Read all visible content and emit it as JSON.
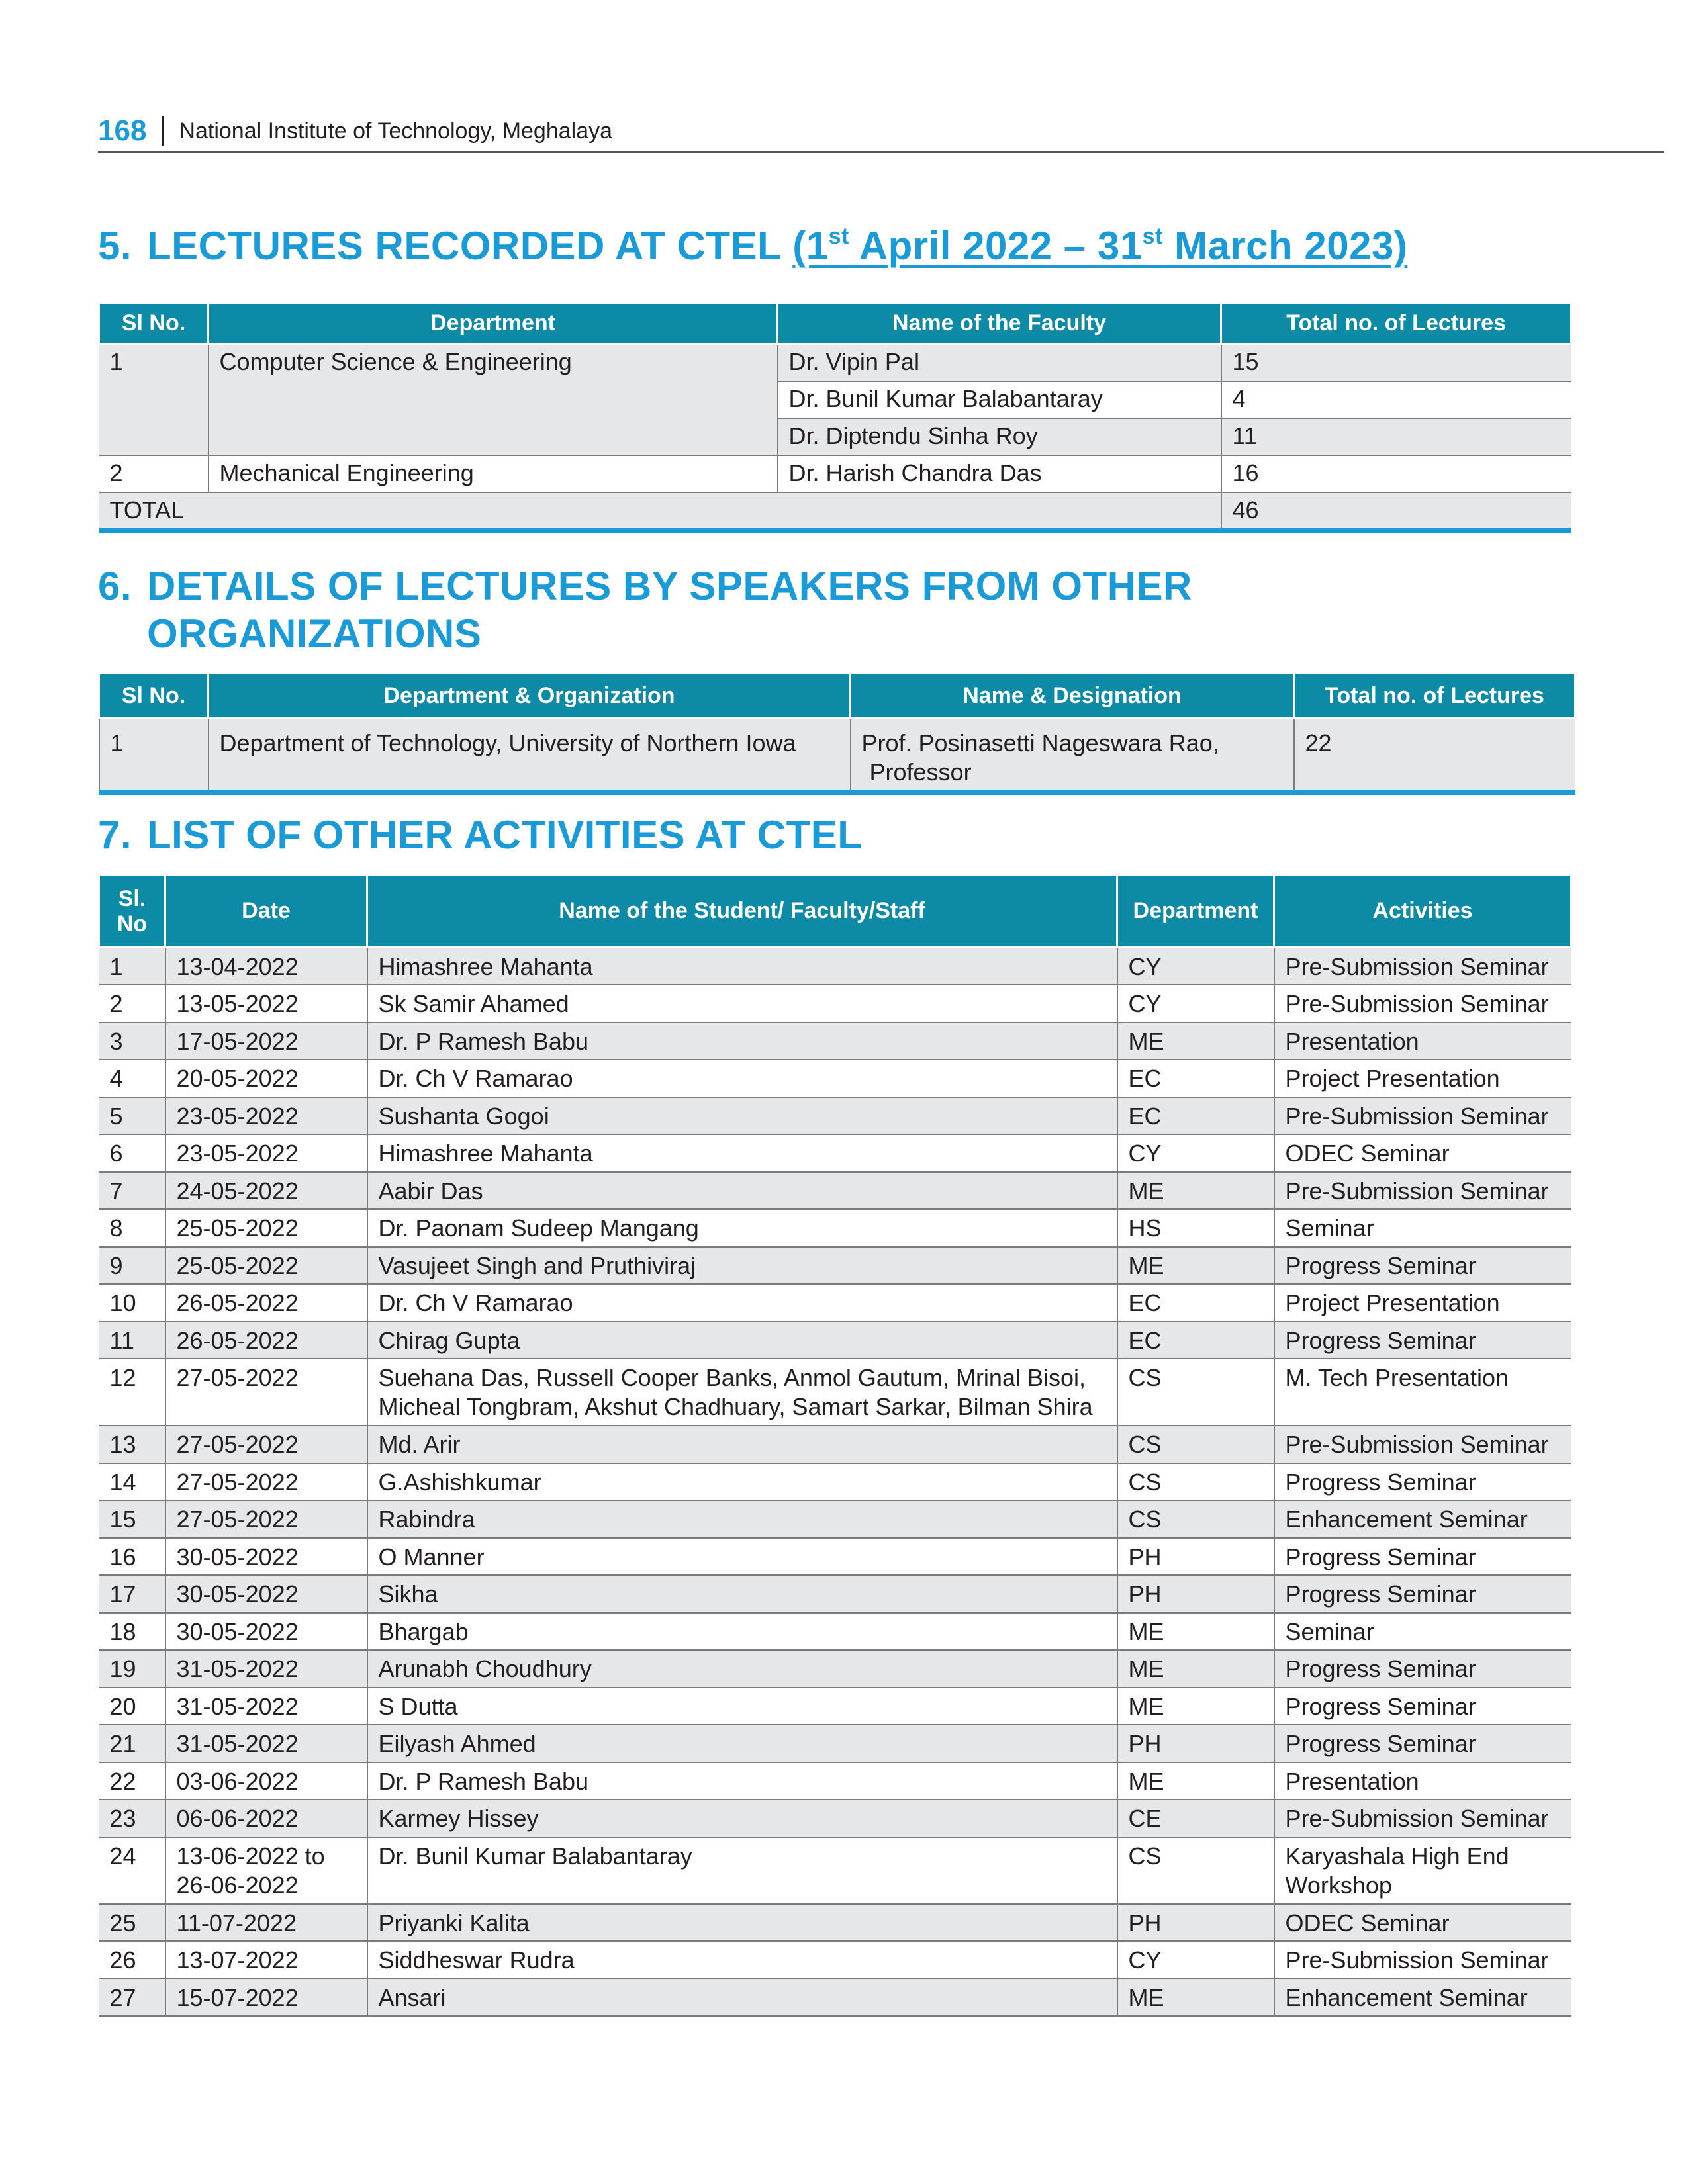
{
  "header": {
    "page_number": "168",
    "title": "National Institute of Technology, Meghalaya"
  },
  "section5": {
    "number": "5.",
    "title_main": "LECTURES RECORDED AT CTEL",
    "title_period": {
      "p1": "(1",
      "sup1": "st",
      "p2": " April 2022 – 31",
      "sup2": "st",
      "p3": " March 2023)"
    },
    "columns": [
      "Sl No.",
      "Department",
      "Name of the Faculty",
      "Total no. of Lectures"
    ],
    "rows": [
      {
        "sl": "1",
        "department": "Computer Science & Engineering",
        "faculty": "Dr. Vipin Pal",
        "lectures": "15"
      },
      {
        "faculty": "Dr. Bunil Kumar Balabantaray",
        "lectures": "4"
      },
      {
        "faculty": "Dr. Diptendu Sinha Roy",
        "lectures": "11"
      },
      {
        "sl": "2",
        "department": "Mechanical Engineering",
        "faculty": "Dr. Harish Chandra Das",
        "lectures": "16"
      }
    ],
    "total": {
      "label": "TOTAL",
      "value": "46"
    }
  },
  "section6": {
    "number": "6.",
    "title_line1": "DETAILS OF LECTURES BY SPEAKERS FROM OTHER",
    "title_line2": "ORGANIZATIONS",
    "columns": [
      "Sl No.",
      "Department & Organization",
      "Name & Designation",
      "Total no. of Lectures"
    ],
    "rows": [
      {
        "sl": "1",
        "organization": "Department of Technology, University of Northern Iowa",
        "name_line1": "Prof. Posinasetti Nageswara Rao,",
        "name_line2": "Professor",
        "lectures": "22"
      }
    ]
  },
  "section7": {
    "number": "7.",
    "title": "LIST OF OTHER ACTIVITIES AT CTEL",
    "columns": {
      "sl_line1": "Sl.",
      "sl_line2": "No",
      "date": "Date",
      "name": "Name of the Student/ Faculty/Staff",
      "department": "Department",
      "activities": "Activities"
    },
    "rows": [
      {
        "sl": "1",
        "date": "13-04-2022",
        "name": "Himashree Mahanta",
        "dept": "CY",
        "activity": "Pre-Submission Seminar"
      },
      {
        "sl": "2",
        "date": "13-05-2022",
        "name": "Sk Samir Ahamed",
        "dept": "CY",
        "activity": "Pre-Submission Seminar"
      },
      {
        "sl": "3",
        "date": "17-05-2022",
        "name": "Dr. P Ramesh Babu",
        "dept": "ME",
        "activity": "Presentation"
      },
      {
        "sl": "4",
        "date": "20-05-2022",
        "name": "Dr. Ch V Ramarao",
        "dept": "EC",
        "activity": "Project Presentation"
      },
      {
        "sl": "5",
        "date": "23-05-2022",
        "name": "Sushanta Gogoi",
        "dept": "EC",
        "activity": "Pre-Submission Seminar"
      },
      {
        "sl": "6",
        "date": "23-05-2022",
        "name": "Himashree Mahanta",
        "dept": "CY",
        "activity": "ODEC Seminar"
      },
      {
        "sl": "7",
        "date": "24-05-2022",
        "name": "Aabir Das",
        "dept": "ME",
        "activity": "Pre-Submission Seminar"
      },
      {
        "sl": "8",
        "date": "25-05-2022",
        "name": "Dr. Paonam Sudeep Mangang",
        "dept": "HS",
        "activity": "Seminar"
      },
      {
        "sl": "9",
        "date": "25-05-2022",
        "name": "Vasujeet Singh and Pruthiviraj",
        "dept": "ME",
        "activity": "Progress Seminar"
      },
      {
        "sl": "10",
        "date": "26-05-2022",
        "name": "Dr. Ch V Ramarao",
        "dept": "EC",
        "activity": "Project Presentation"
      },
      {
        "sl": "11",
        "date": "26-05-2022",
        "name": "Chirag Gupta",
        "dept": "EC",
        "activity": "Progress Seminar"
      },
      {
        "sl": "12",
        "date": "27-05-2022",
        "name": "Suehana Das, Russell Cooper Banks, Anmol Gautum, Mrinal Bisoi,",
        "name2": "Micheal Tongbram, Akshut Chadhuary, Samart Sarkar, Bilman Shira",
        "dept": "CS",
        "activity": "M. Tech Presentation"
      },
      {
        "sl": "13",
        "date": "27-05-2022",
        "name": "Md. Arir",
        "dept": "CS",
        "activity": "Pre-Submission Seminar"
      },
      {
        "sl": "14",
        "date": "27-05-2022",
        "name": "G.Ashishkumar",
        "dept": "CS",
        "activity": "Progress Seminar"
      },
      {
        "sl": "15",
        "date": "27-05-2022",
        "name": "Rabindra",
        "dept": "CS",
        "activity": "Enhancement Seminar"
      },
      {
        "sl": "16",
        "date": "30-05-2022",
        "name": "O Manner",
        "dept": "PH",
        "activity": "Progress Seminar"
      },
      {
        "sl": "17",
        "date": "30-05-2022",
        "name": "Sikha",
        "dept": "PH",
        "activity": "Progress Seminar"
      },
      {
        "sl": "18",
        "date": "30-05-2022",
        "name": "Bhargab",
        "dept": "ME",
        "activity": "Seminar"
      },
      {
        "sl": "19",
        "date": "31-05-2022",
        "name": "Arunabh Choudhury",
        "dept": "ME",
        "activity": "Progress Seminar"
      },
      {
        "sl": "20",
        "date": "31-05-2022",
        "name": "S Dutta",
        "dept": "ME",
        "activity": "Progress Seminar"
      },
      {
        "sl": "21",
        "date": "31-05-2022",
        "name": "Eilyash Ahmed",
        "dept": "PH",
        "activity": "Progress Seminar"
      },
      {
        "sl": "22",
        "date": "03-06-2022",
        "name": "Dr. P Ramesh Babu",
        "dept": "ME",
        "activity": "Presentation"
      },
      {
        "sl": "23",
        "date": "06-06-2022",
        "name": "Karmey Hissey",
        "dept": "CE",
        "activity": "Pre-Submission Seminar"
      },
      {
        "sl": "24",
        "date": "13-06-2022 to",
        "date2": "26-06-2022",
        "name": "Dr. Bunil Kumar Balabantaray",
        "dept": "CS",
        "activity": "Karyashala High End",
        "activity2": "Workshop"
      },
      {
        "sl": "25",
        "date": "11-07-2022",
        "name": "Priyanki Kalita",
        "dept": "PH",
        "activity": "ODEC Seminar"
      },
      {
        "sl": "26",
        "date": "13-07-2022",
        "name": "Siddheswar Rudra",
        "dept": "CY",
        "activity": "Pre-Submission Seminar"
      },
      {
        "sl": "27",
        "date": "15-07-2022",
        "name": "Ansari",
        "dept": "ME",
        "activity": "Enhancement Seminar"
      }
    ]
  }
}
